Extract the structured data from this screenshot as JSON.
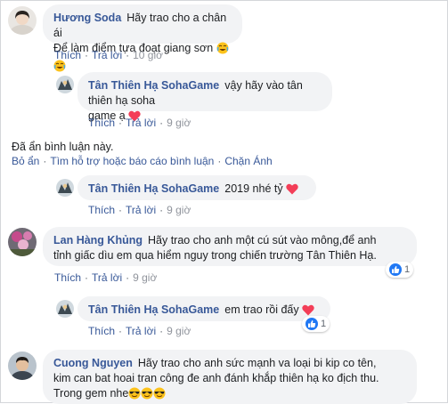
{
  "comments": [
    {
      "author": "Hương Soda",
      "lines": [
        "Hãy trao cho a chân ái",
        "Để làm điểm tựa đoạt giang sơn"
      ],
      "emojis": [
        "face-with-tears-of-joy",
        "face-with-tears-of-joy"
      ],
      "like": "Thích",
      "reply": "Trả lời",
      "time": "10 giờ"
    },
    {
      "author": "Tân Thiên Hạ SohaGame",
      "text_line1": "vậy hãy vào tân thiên hạ soha",
      "text_line2": "game ạ",
      "like": "Thích",
      "reply": "Trả lời",
      "time": "9 giờ"
    },
    {
      "author": "Tân Thiên Hạ SohaGame",
      "text": "2019 nhé tỷ",
      "like": "Thích",
      "reply": "Trả lời",
      "time": "9 giờ"
    },
    {
      "author": "Lan Hàng Khủng",
      "text_line1": "Hãy trao cho anh một cú sút vào mông,để anh",
      "text_line2": "tỉnh giấc dìu em qua hiểm nguy trong chiến trường Tân Thiên Hạ.",
      "reaction_count": "1",
      "like": "Thích",
      "reply": "Trả lời",
      "time": "9 giờ"
    },
    {
      "author": "Tân Thiên Hạ SohaGame",
      "text": "em trao rồi đấy",
      "reaction_count": "1",
      "like": "Thích",
      "reply": "Trả lời",
      "time": "9 giờ"
    },
    {
      "author": "Cuong Nguyen",
      "text_line1": "Hãy trao cho anh sức mạnh va loại bi kip co tên,",
      "text_line2": "kim can bat hoai tran công đe anh đánh khắp thiên hạ ko địch thu.",
      "text_line3": "Trong gem nhe",
      "emojis": [
        "smiling-face-with-sunglasses",
        "smiling-face-with-sunglasses",
        "smiling-face-with-sunglasses"
      ]
    }
  ],
  "hidden_notice": {
    "text": "Đã ẩn bình luận này.",
    "unhide": "Bỏ ẩn",
    "support": "Tìm hỗ trợ hoặc báo cáo bình luận",
    "block": "Chặn Ánh"
  },
  "separator": "·",
  "colors": {
    "link": "#385898",
    "bubble": "#f2f3f5",
    "meta": "#606770",
    "heart": "#f33e58",
    "like_blue": "#2078f4"
  }
}
